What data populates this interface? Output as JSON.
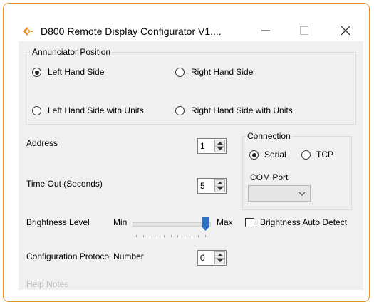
{
  "window": {
    "title": "D800 Remote Display Configurator V1....",
    "icon": "app-logo-icon",
    "accent_color": "#e8922e",
    "minimize_icon": "minimize-icon",
    "maximize_icon": "maximize-icon",
    "close_icon": "close-icon"
  },
  "annunciator": {
    "group_label": "Annunciator Position",
    "options": [
      {
        "label": "Left Hand Side",
        "checked": true
      },
      {
        "label": "Right Hand Side",
        "checked": false
      },
      {
        "label": "Left Hand Side with Units",
        "checked": false
      },
      {
        "label": "Right Hand Side with Units",
        "checked": false
      }
    ]
  },
  "address": {
    "label": "Address",
    "value": "1"
  },
  "timeout": {
    "label": "Time Out (Seconds)",
    "value": "5"
  },
  "connection": {
    "group_label": "Connection",
    "serial_label": "Serial",
    "tcp_label": "TCP",
    "selected": "Serial",
    "com_port_label": "COM Port",
    "com_port_value": ""
  },
  "brightness": {
    "label": "Brightness Level",
    "min_label": "Min",
    "max_label": "Max",
    "value_fraction": 1.0,
    "auto_detect_label": "Brightness Auto Detect",
    "auto_detect_checked": false,
    "thumb_color": "#2f6fc4"
  },
  "protocol": {
    "label": "Configuration Protocol Number",
    "value": "0"
  },
  "help": {
    "label": "Help Notes"
  }
}
